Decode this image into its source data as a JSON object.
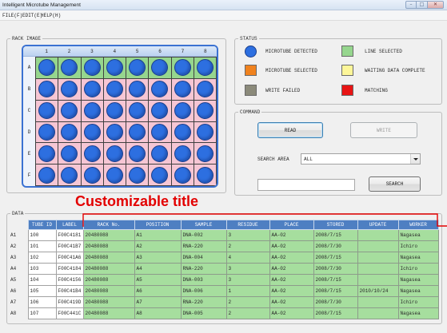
{
  "window": {
    "title": "Intelligent Microtube Management"
  },
  "menu": {
    "items": [
      "FILE(F)",
      "EDIT(E)",
      "HELP(H)"
    ]
  },
  "colors": {
    "tube": "#2d6fe0",
    "line_selected": "#96d68e",
    "rack_row": "#f6c6d4",
    "rack_border": "#3b72d2",
    "header": "#4e7fc2",
    "cell_green": "#a6de9e",
    "annotation": "#e30000"
  },
  "rack": {
    "title": "RACK IMAGE",
    "columns": [
      "1",
      "2",
      "3",
      "4",
      "5",
      "6",
      "7",
      "8"
    ],
    "rows": [
      {
        "label": "A",
        "selected": true,
        "tubes": [
          true,
          true,
          true,
          true,
          true,
          true,
          true,
          true
        ]
      },
      {
        "label": "B",
        "selected": false,
        "tubes": [
          true,
          true,
          true,
          true,
          true,
          true,
          true,
          true
        ]
      },
      {
        "label": "C",
        "selected": false,
        "tubes": [
          true,
          true,
          true,
          true,
          true,
          true,
          true,
          true
        ]
      },
      {
        "label": "D",
        "selected": false,
        "tubes": [
          true,
          true,
          true,
          true,
          true,
          true,
          true,
          true
        ]
      },
      {
        "label": "E",
        "selected": false,
        "tubes": [
          true,
          true,
          true,
          true,
          true,
          true,
          true,
          true
        ]
      },
      {
        "label": "F",
        "selected": false,
        "tubes": [
          true,
          true,
          true,
          true,
          true,
          true,
          true,
          true
        ]
      }
    ]
  },
  "status": {
    "title": "STATUS",
    "legend": [
      {
        "label": "MICROTUBE DETECTED",
        "color": "#2d6fe0"
      },
      {
        "label": "LINE SELECTED",
        "color": "#96d68e"
      },
      {
        "label": "MICROTUBE SELECTED",
        "color": "#f0821e"
      },
      {
        "label": "WAITING DATA COMPLETE",
        "color": "#fdf699"
      },
      {
        "label": "WRITE FAILED",
        "color": "#8b8a7a"
      },
      {
        "label": "MATCHING",
        "color": "#e81414"
      }
    ]
  },
  "command": {
    "title": "COMMAND",
    "read_label": "READ",
    "write_label": "WRITE",
    "write_enabled": false,
    "search_area_label": "SEARCH AREA",
    "search_area_value": "ALL",
    "search_value": "",
    "search_label": "SEARCH"
  },
  "annotation": {
    "text": "Customizable title"
  },
  "data": {
    "title": "DATA",
    "columns": [
      "TUBE ID",
      "LABEL",
      "RACK No.",
      "POSITION",
      "SAMPLE",
      "RESIDUE",
      "PLACE",
      "STORED",
      "UPDATE",
      "WORKER"
    ],
    "rows": [
      {
        "label": "A1",
        "cells": [
          "100",
          "F00C4181",
          "20480088",
          "A1",
          "DNA-002",
          "3",
          "AA-02",
          "2008/7/15",
          "",
          "Nagasea"
        ]
      },
      {
        "label": "A2",
        "cells": [
          "101",
          "F00C41B7",
          "20480088",
          "A2",
          "RNA-220",
          "2",
          "AA-02",
          "2008/7/30",
          "",
          "Ichiro"
        ]
      },
      {
        "label": "A3",
        "cells": [
          "102",
          "F00C41A6",
          "20480088",
          "A3",
          "DNA-004",
          "4",
          "AA-02",
          "2008/7/15",
          "",
          "Nagasea"
        ]
      },
      {
        "label": "A4",
        "cells": [
          "103",
          "F00C4184",
          "20480088",
          "A4",
          "RNA-220",
          "3",
          "AA-02",
          "2008/7/30",
          "",
          "Ichiro"
        ]
      },
      {
        "label": "A5",
        "cells": [
          "104",
          "F00C4156",
          "20480088",
          "A5",
          "DNA-003",
          "3",
          "AA-02",
          "2008/7/15",
          "",
          "Nagasea"
        ]
      },
      {
        "label": "A6",
        "cells": [
          "105",
          "F00C41B4",
          "20480088",
          "A6",
          "DNA-006",
          "1",
          "AA-02",
          "2008/7/15",
          "2010/10/24",
          "Nagasea"
        ]
      },
      {
        "label": "A7",
        "cells": [
          "106",
          "F00C419D",
          "20480088",
          "A7",
          "RNA-220",
          "2",
          "AA-02",
          "2008/7/30",
          "",
          "Ichiro"
        ]
      },
      {
        "label": "A8",
        "cells": [
          "107",
          "F00C441C",
          "20480088",
          "A8",
          "DNA-005",
          "2",
          "AA-02",
          "2008/7/15",
          "",
          "Nagasea"
        ]
      }
    ]
  }
}
